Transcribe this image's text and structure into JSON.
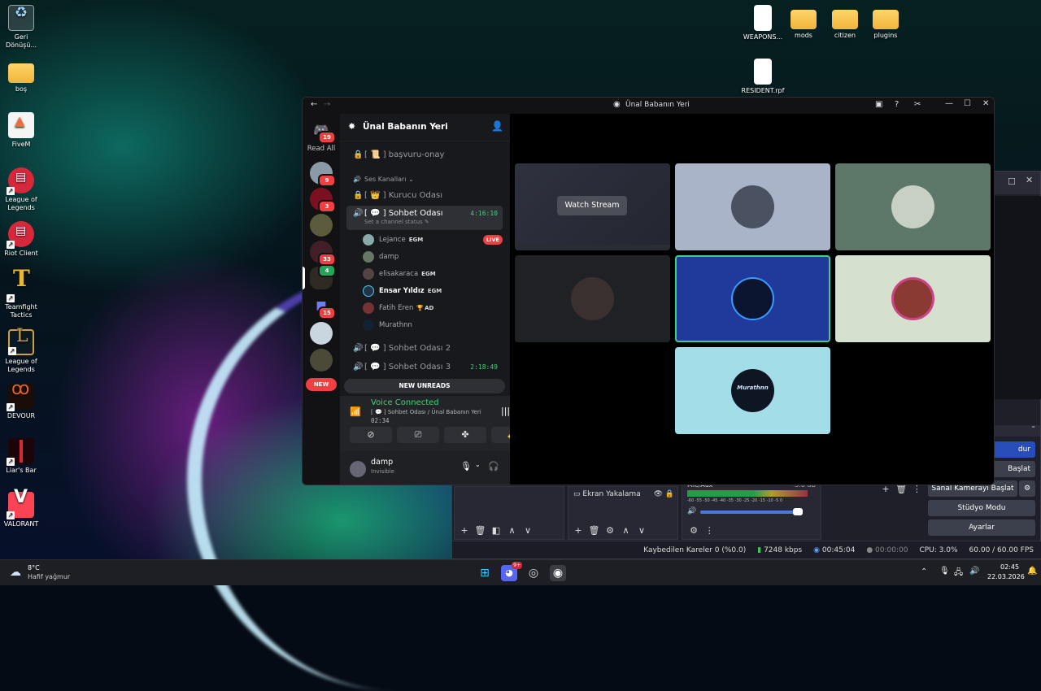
{
  "desktop": {
    "icons_left": [
      {
        "label": "Geri\nDönüşü...",
        "icon": "recycle-bin-icon"
      },
      {
        "label": "boş",
        "icon": "folder-icon"
      },
      {
        "label": "FiveM",
        "icon": "fivem-icon"
      },
      {
        "label": "League of\nLegends",
        "icon": "riot-icon"
      },
      {
        "label": "Riot Client",
        "icon": "riot-icon"
      },
      {
        "label": "Teamfight\nTactics",
        "icon": "tft-icon"
      },
      {
        "label": "League of\nLegends",
        "icon": "lol-icon"
      },
      {
        "label": "DEVOUR",
        "icon": "devour-icon"
      },
      {
        "label": "Liar's Bar",
        "icon": "liars-bar-icon"
      },
      {
        "label": "VALORANT",
        "icon": "valorant-icon"
      }
    ],
    "icons_right": [
      {
        "label": "WEAPONS...",
        "icon": "file-icon"
      },
      {
        "label": "mods",
        "icon": "folder-icon"
      },
      {
        "label": "citizen",
        "icon": "folder-icon"
      },
      {
        "label": "plugins",
        "icon": "folder-icon"
      },
      {
        "label": "RESIDENT.rpf",
        "icon": "file-icon"
      }
    ]
  },
  "obs": {
    "buttons": [
      "dur",
      "Başlat",
      "Sanal Kamerayı Başlat",
      "Stüdyo Modu",
      "Ayarlar"
    ],
    "sources_item": "Ekran Yakalama",
    "audio_label": "Mic/Aux",
    "audio_db": "-3.6 dB",
    "meter_ticks": "-60 -55 -50 -45 -40 -35 -30 -25 -20 -15 -10 -5 0",
    "status": {
      "dropped": "Kaybedilen Kareler 0 (%0.0)",
      "bitrate": "7248 kbps",
      "stream_time": "00:45:04",
      "rec_time": "00:00:00",
      "cpu": "CPU: 3.0%",
      "fps": "60.00 / 60.00 FPS"
    }
  },
  "discord": {
    "window_title": "Ünal Babanın Yeri",
    "server_name": "Ünal Babanın Yeri",
    "dm_badge": "19",
    "read_all": "Read All",
    "server_badges": [
      "9",
      "3",
      "33",
      "4",
      "15"
    ],
    "new_label": "NEW",
    "channels": {
      "basvuru": "[ 📜 ] başvuru-onay",
      "category": "Ses Kanalları",
      "kurucu": "[ 👑 ] Kurucu Odası",
      "sohbet1": "[ 💬 ] Sohbet Odası",
      "sohbet1_time": "4:16:10",
      "sohbet1_status": "Set a channel status",
      "sohbet2": "[ 💬 ] Sohbet Odası 2",
      "sohbet3": "[ 💬 ] Sohbet Odası 3",
      "sohbet3_time": "2:18:49"
    },
    "voice_users": [
      {
        "name": "Lejance",
        "tag": "EGM",
        "live": "LIVE"
      },
      {
        "name": "damp",
        "tag": ""
      },
      {
        "name": "elisakaraca",
        "tag": "EGM"
      },
      {
        "name": "Ensar Yıldız",
        "tag": "EGM"
      },
      {
        "name": "Fatih Eren",
        "tag": "AD"
      },
      {
        "name": "Murathnn",
        "tag": ""
      }
    ],
    "new_unreads": "NEW UNREADS",
    "voice_connected": "Voice Connected",
    "voice_channel": "[ 💬 ] Sohbet Odası / Ünal Babanın Yeri",
    "voice_time": "02:34",
    "user_name": "damp",
    "user_status": "Invisible",
    "watch_stream": "Watch Stream",
    "murathnn_label": "Murathnn"
  },
  "taskbar": {
    "weather_temp": "8°C",
    "weather_desc": "Hafif yağmur",
    "discord_badge": "9+",
    "time": "02:45",
    "date": "22.03.2026"
  }
}
